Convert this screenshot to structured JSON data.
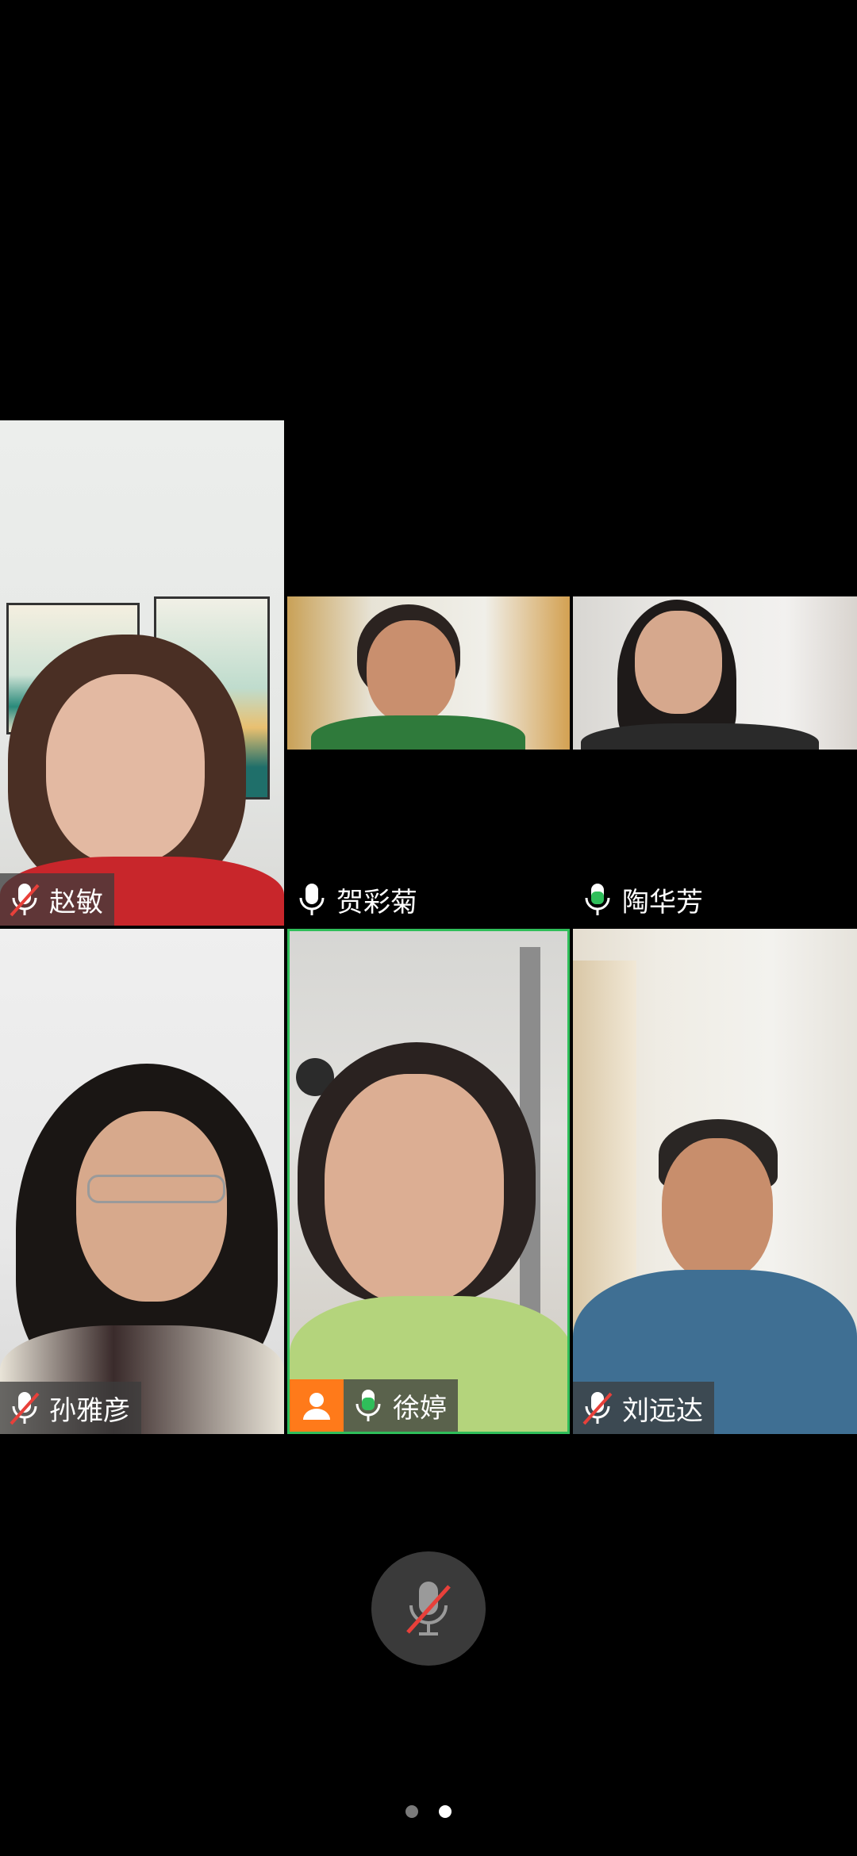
{
  "participants": [
    {
      "name": "赵敏",
      "mic": "muted"
    },
    {
      "name": "贺彩菊",
      "mic": "on"
    },
    {
      "name": "陶华芳",
      "mic": "speaking"
    },
    {
      "name": "孙雅彦",
      "mic": "muted"
    },
    {
      "name": "徐婷",
      "mic": "speaking",
      "host": true,
      "active_speaker": true
    },
    {
      "name": "刘远达",
      "mic": "muted"
    }
  ],
  "controls": {
    "mic_state": "muted",
    "mic_icon": "mic-muted-icon"
  },
  "pagination": {
    "pages": 2,
    "current": 2
  },
  "colors": {
    "background": "#000000",
    "speaking_green": "#2fbe5a",
    "muted_red": "#e8403a",
    "host_orange": "#ff7a1a"
  }
}
